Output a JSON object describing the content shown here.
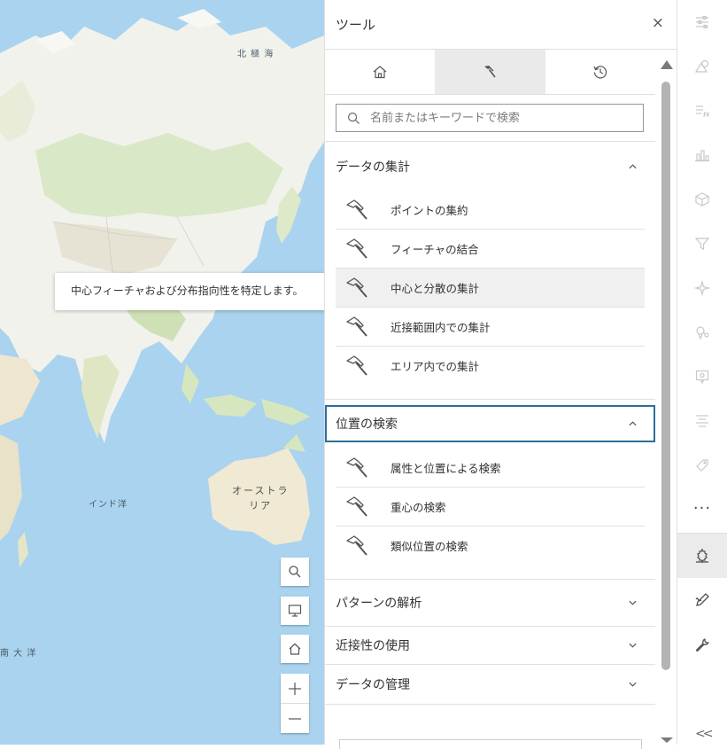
{
  "map": {
    "labels": {
      "arctic": "北 極 海",
      "indian": "インド洋",
      "southern": "南 大 洋",
      "australia_line1": "オーストラ",
      "australia_line2": "リア"
    },
    "tooltip": "中心フィーチャおよび分布指向性を特定します。",
    "buttons": [
      "search-icon",
      "monitor-icon",
      "home-icon",
      "zoom-in",
      "zoom-out"
    ]
  },
  "panel": {
    "title": "ツール",
    "close": "×",
    "tabs": [
      {
        "icon": "home-icon",
        "active": false
      },
      {
        "icon": "hammer-icon",
        "active": true
      },
      {
        "icon": "history-icon",
        "active": false
      }
    ],
    "search": {
      "placeholder": "名前またはキーワードで検索",
      "value": ""
    },
    "sections": [
      {
        "title": "データの集計",
        "expanded": true,
        "tools": [
          "ポイントの集約",
          "フィーチャの結合",
          "中心と分散の集計",
          "近接範囲内での集計",
          "エリア内での集計"
        ]
      },
      {
        "title": "位置の検索",
        "expanded": true,
        "tools": [
          "属性と位置による検索",
          "重心の検索",
          "類似位置の検索"
        ]
      },
      {
        "title": "パターンの解析",
        "expanded": false
      },
      {
        "title": "近接性の使用",
        "expanded": false
      },
      {
        "title": "データの管理",
        "expanded": false
      }
    ]
  },
  "actionbar": {
    "more": "···",
    "collapse": "<<",
    "colors": {
      "disabled": "#c8c8c8",
      "enabled": "#505050",
      "active_bg": "#ebebeb"
    }
  }
}
